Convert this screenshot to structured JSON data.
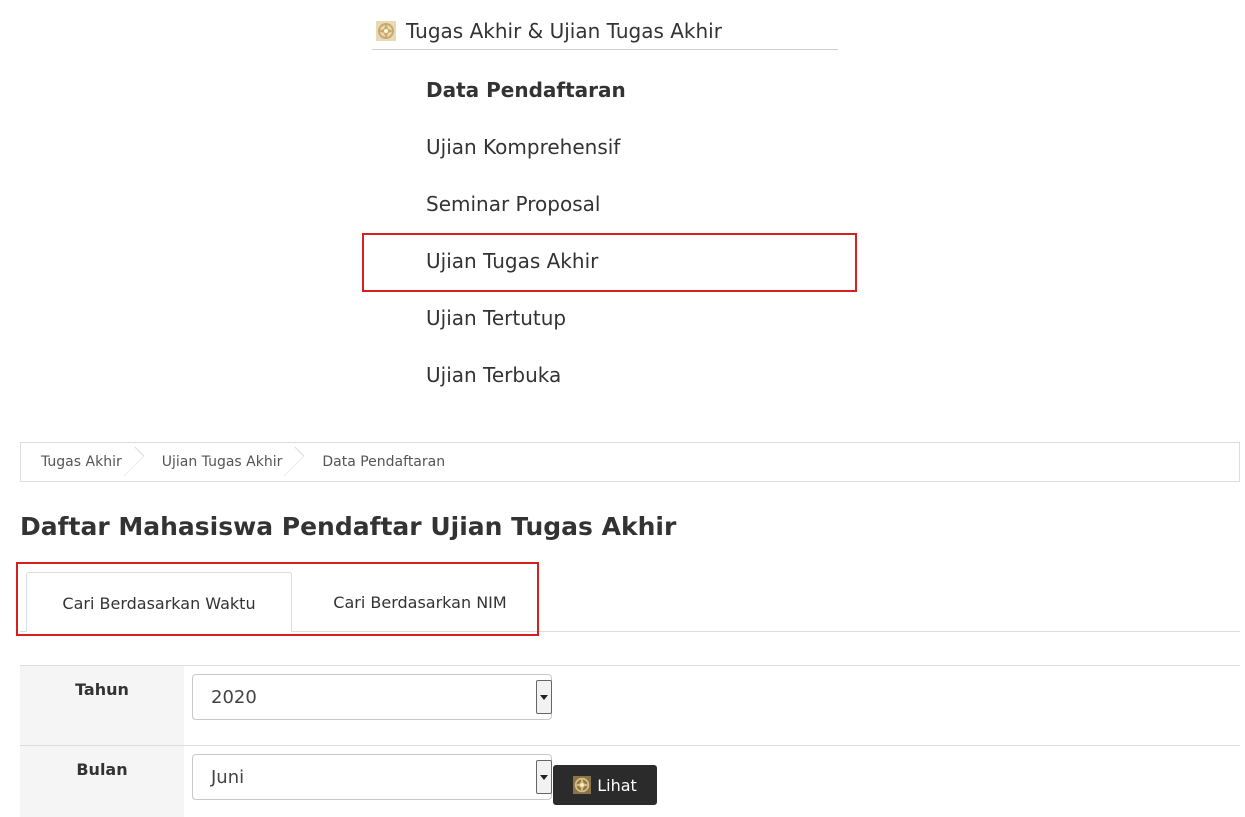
{
  "colors": {
    "highlight": "#d42020",
    "ornament": "#c9a96a",
    "button_bg": "#2b2b2b",
    "label_cell_bg": "#f5f5f5"
  },
  "menu": {
    "icon": "gold-ornament-icon",
    "title": "Tugas Akhir & Ujian Tugas Akhir",
    "items": [
      {
        "label": "Data Pendaftaran",
        "bold": true
      },
      {
        "label": "Ujian Komprehensif"
      },
      {
        "label": "Seminar Proposal"
      },
      {
        "label": "Ujian Tugas Akhir",
        "highlighted": true
      },
      {
        "label": "Ujian Tertutup"
      },
      {
        "label": "Ujian Terbuka"
      }
    ]
  },
  "breadcrumb": [
    "Tugas Akhir",
    "Ujian Tugas Akhir",
    "Data Pendaftaran"
  ],
  "page": {
    "title": "Daftar Mahasiswa Pendaftar Ujian Tugas Akhir"
  },
  "tabs": [
    {
      "label": "Cari Berdasarkan Waktu",
      "active": true
    },
    {
      "label": "Cari Berdasarkan NIM",
      "active": false
    }
  ],
  "form": {
    "tahun": {
      "label": "Tahun",
      "value": "2020"
    },
    "bulan": {
      "label": "Bulan",
      "value": "Juni"
    },
    "submit": {
      "label": "Lihat",
      "icon": "gold-ornament-icon"
    }
  }
}
